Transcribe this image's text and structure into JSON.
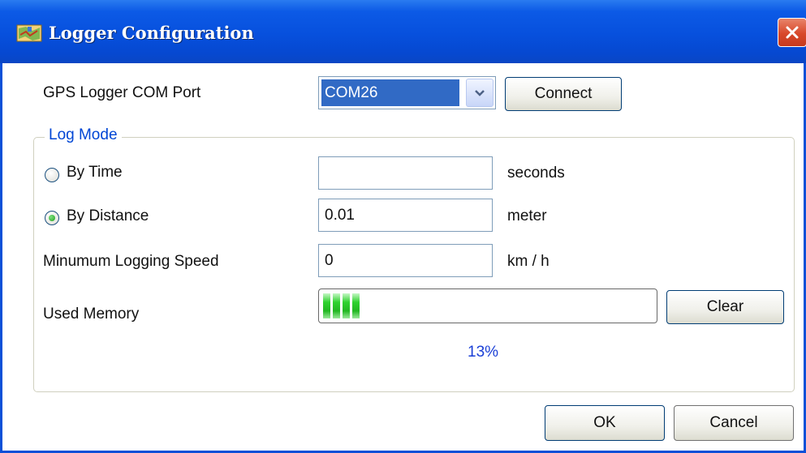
{
  "window": {
    "title": "Logger Configuration"
  },
  "port": {
    "label": "GPS Logger COM Port",
    "selected": "COM26",
    "connect_label": "Connect"
  },
  "log_mode": {
    "group_label": "Log Mode",
    "by_time": {
      "label": "By Time",
      "value": "",
      "unit": "seconds",
      "checked": false
    },
    "by_distance": {
      "label": "By Distance",
      "value": "0.01",
      "unit": "meter",
      "checked": true
    },
    "min_speed": {
      "label": "Minumum Logging Speed",
      "value": "0",
      "unit": "km / h"
    },
    "memory": {
      "label": "Used Memory",
      "percent_text": "13%",
      "percent_value": 13,
      "clear_label": "Clear"
    }
  },
  "footer": {
    "ok_label": "OK",
    "cancel_label": "Cancel"
  },
  "colors": {
    "title_bar": "#0750dd",
    "selection": "#316ac5",
    "group_label": "#0046d5",
    "progress_fill": "#2fd22f",
    "percent_text": "#1a3fd6"
  },
  "icons": {
    "app": "map-icon",
    "close": "close-icon",
    "dropdown": "chevron-down-icon"
  }
}
